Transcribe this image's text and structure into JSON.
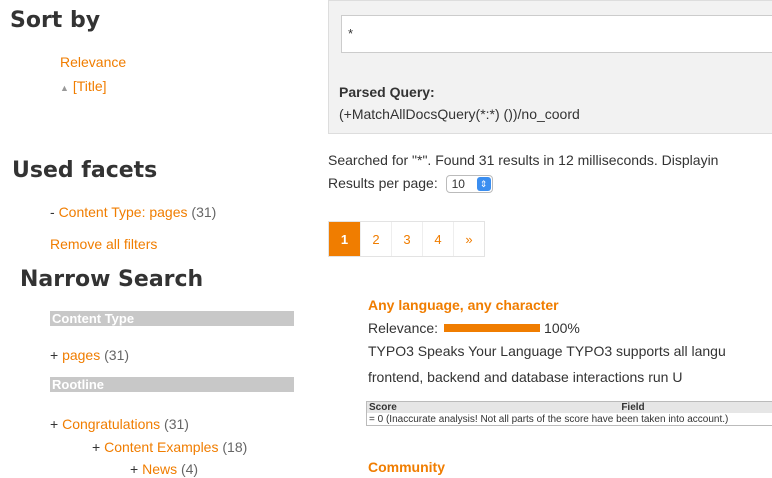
{
  "sort": {
    "title": "Sort by",
    "items": [
      {
        "label": "Relevance",
        "prefix": ""
      },
      {
        "label": "[Title]",
        "prefix": "▲"
      }
    ]
  },
  "used_facets": {
    "title": "Used facets",
    "items": [
      {
        "prefix": "-",
        "label": "Content Type: pages",
        "count": "(31)"
      }
    ],
    "remove_all": "Remove all filters"
  },
  "narrow": {
    "title": "Narrow Search",
    "groups": [
      {
        "header": "Content Type",
        "items": [
          {
            "prefix": "+",
            "label": "pages",
            "count": "(31)"
          }
        ]
      },
      {
        "header": "Rootline",
        "items": [
          {
            "prefix": "+",
            "label": "Congratulations",
            "count": "(31)"
          },
          {
            "prefix": "+",
            "label": "Content Examples",
            "count": "(18)"
          },
          {
            "prefix": "+",
            "label": "News",
            "count": "(4)"
          }
        ]
      }
    ]
  },
  "query": {
    "value": "*",
    "parsed_label": "Parsed Query:",
    "parsed_value": "(+MatchAllDocsQuery(*:*) ())/no_coord"
  },
  "status": {
    "text": "Searched for \"*\". Found 31 results in 12 milliseconds. Displayin",
    "rpp_label": "Results per page:",
    "rpp_value": "10"
  },
  "pager": {
    "pages": [
      "1",
      "2",
      "3",
      "4",
      "»"
    ],
    "active": 0
  },
  "results": [
    {
      "title": "Any language, any character",
      "relevance_label": "Relevance:",
      "relevance_value": "100%",
      "relevance_fraction": 1.0,
      "snippet_line1": "TYPO3 Speaks Your Language TYPO3 supports all langu",
      "snippet_line2": "frontend, backend and database interactions run U",
      "score_table": {
        "headers": [
          "Score",
          "Field"
        ],
        "row": "= 0 (Inaccurate analysis! Not all parts of the score have been taken into account.)"
      }
    },
    {
      "title": "Community"
    }
  ],
  "colors": {
    "accent": "#f07d00",
    "facet_header_bg": "#c8c8c8"
  }
}
